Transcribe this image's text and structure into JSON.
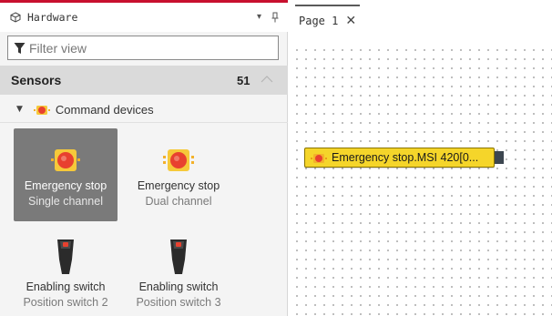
{
  "panel": {
    "title": "Hardware",
    "icon": "cube-icon",
    "dropdown_icon": "▾",
    "pin_icon": "pin-icon"
  },
  "filter": {
    "placeholder": "Filter view",
    "icon": "funnel-icon"
  },
  "section": {
    "title": "Sensors",
    "count": "51",
    "collapse_icon": "chevron-up-icon"
  },
  "group": {
    "arrow": "▼",
    "icon": "emergency-stop-icon",
    "label": "Command devices"
  },
  "tiles": [
    {
      "line1": "Emergency stop",
      "line2": "Single channel",
      "icon": "emergency-stop-single-icon",
      "selected": true
    },
    {
      "line1": "Emergency stop",
      "line2": "Dual channel",
      "icon": "emergency-stop-dual-icon",
      "selected": false
    },
    {
      "line1": "Enabling switch",
      "line2": "Position switch 2",
      "icon": "enabling-switch-icon",
      "selected": false
    },
    {
      "line1": "Enabling switch",
      "line2": "Position switch 3",
      "icon": "enabling-switch-icon",
      "selected": false
    }
  ],
  "tab": {
    "label": "Page 1",
    "close": "✕"
  },
  "canvas": {
    "block_label": "Emergency stop.MSI 420[0..."
  },
  "colors": {
    "accent": "#c8102e",
    "block_fill": "#f5d52a",
    "button_red": "#e8412f",
    "selected_tile": "#7a7a7a"
  }
}
